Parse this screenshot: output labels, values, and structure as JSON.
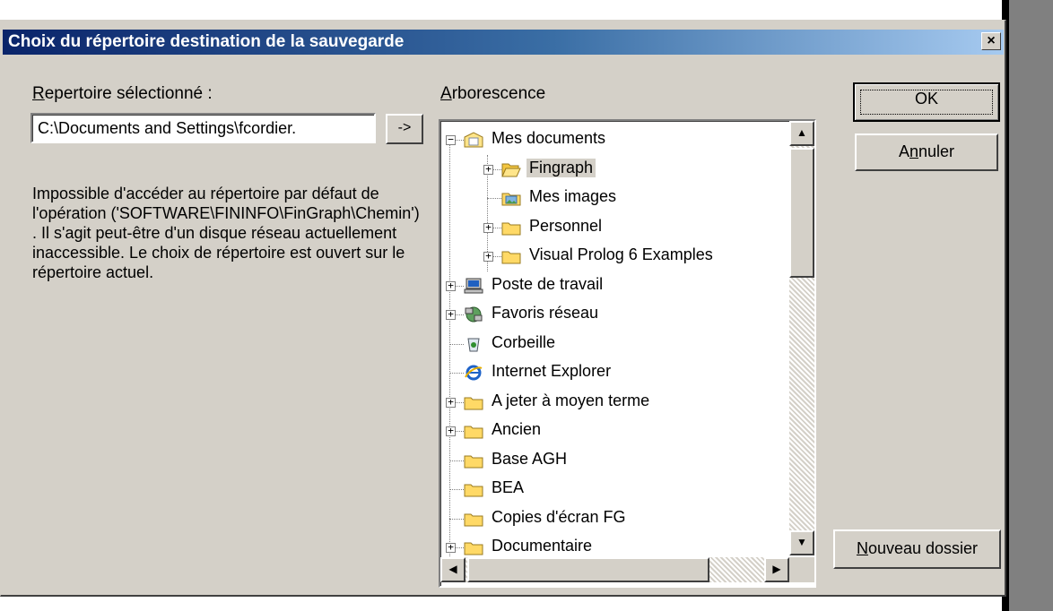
{
  "dialog": {
    "title": "Choix du répertoire destination de la sauvegarde",
    "close_label": "×"
  },
  "left": {
    "label_first": "R",
    "label_rest": "epertoire sélectionné :",
    "path_value": "C:\\Documents and Settings\\fcordier.",
    "arrow_label": "->",
    "message": "Impossible d'accéder au répertoire par défaut de l'opération ('SOFTWARE\\FININFO\\FinGraph\\Chemin') . Il s'agit peut-être d'un disque réseau actuellement inaccessible. Le choix de répertoire est ouvert sur le répertoire actuel."
  },
  "tree": {
    "label_first": "A",
    "label_rest": "rborescence",
    "items": [
      {
        "label": "Mes documents",
        "icon": "my-documents-icon",
        "expander": "−"
      },
      {
        "label": "Fingraph",
        "icon": "open-folder-icon",
        "expander": "+",
        "selected": true
      },
      {
        "label": "Mes images",
        "icon": "my-pictures-icon",
        "expander": ""
      },
      {
        "label": "Personnel",
        "icon": "folder-icon",
        "expander": "+"
      },
      {
        "label": "Visual Prolog 6 Examples",
        "icon": "folder-icon",
        "expander": "+"
      },
      {
        "label": "Poste de travail",
        "icon": "computer-icon",
        "expander": "+"
      },
      {
        "label": "Favoris réseau",
        "icon": "network-icon",
        "expander": "+"
      },
      {
        "label": "Corbeille",
        "icon": "recycle-bin-icon",
        "expander": ""
      },
      {
        "label": "Internet Explorer",
        "icon": "internet-explorer-icon",
        "expander": ""
      },
      {
        "label": "A jeter à moyen terme",
        "icon": "folder-icon",
        "expander": "+"
      },
      {
        "label": "Ancien",
        "icon": "folder-icon",
        "expander": "+"
      },
      {
        "label": "Base AGH",
        "icon": "folder-icon",
        "expander": ""
      },
      {
        "label": "BEA",
        "icon": "folder-icon",
        "expander": ""
      },
      {
        "label": "Copies d'écran FG",
        "icon": "folder-icon",
        "expander": ""
      },
      {
        "label": "Documentaire",
        "icon": "folder-icon",
        "expander": "+"
      }
    ],
    "scroll_up": "▲",
    "scroll_down": "▼",
    "scroll_left": "◀",
    "scroll_right": "▶"
  },
  "buttons": {
    "ok": "OK",
    "cancel_before": "A",
    "cancel_mnemonic": "n",
    "cancel_after": "nuler",
    "newdir_mnemonic": "N",
    "newdir_rest": "ouveau dossier"
  },
  "colors": {
    "dialog_bg": "#d4d0c8",
    "title_start": "#0a246a",
    "title_end": "#a6caf0"
  }
}
